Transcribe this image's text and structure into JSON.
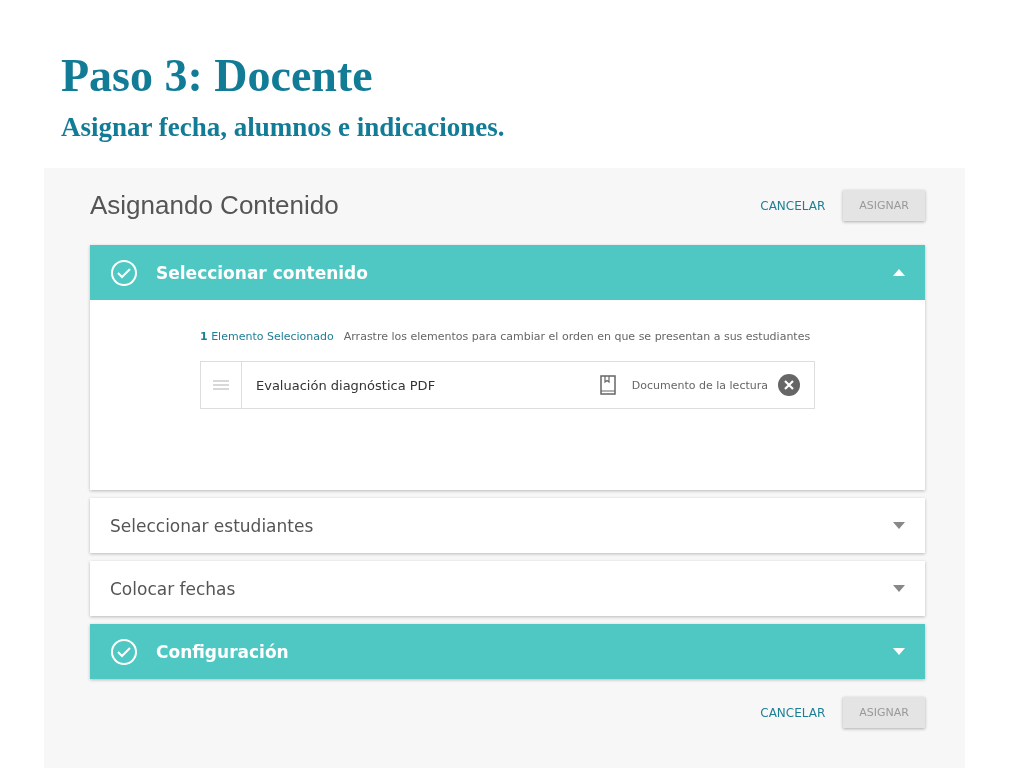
{
  "slide": {
    "title": "Paso 3: Docente",
    "subtitle": "Asignar fecha, alumnos e indicaciones."
  },
  "panel": {
    "title": "Asignando Contenido",
    "top_actions": [
      {
        "label": "CANCELAR",
        "kind": "link",
        "disabled": false
      },
      {
        "label": "ASIGNAR",
        "kind": "raised",
        "disabled": true
      }
    ],
    "sections": [
      {
        "title": "Seleccionar contenido",
        "completed": true,
        "expanded": true,
        "count_text": "**1** Elemento Selecionado",
        "hint": "Arrastre los elementos para cambiar el orden en que se presentan a sus estudiantes",
        "items": [
          {
            "name": "Evaluación diagnóstica PDF",
            "type": "Documento de la lectura"
          }
        ]
      },
      {
        "title": "Seleccionar estudiantes",
        "completed": false,
        "expanded": false
      },
      {
        "title": "Colocar fechas",
        "completed": false,
        "expanded": false
      },
      {
        "title": "Configuración",
        "completed": true,
        "expanded": false
      }
    ],
    "bottom_actions": [
      {
        "label": "CANCELAR",
        "kind": "link",
        "disabled": false
      },
      {
        "label": "ASIGNAR",
        "kind": "raised",
        "disabled": true
      }
    ]
  }
}
